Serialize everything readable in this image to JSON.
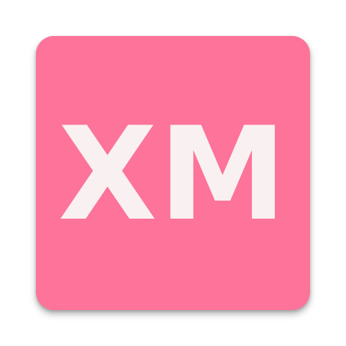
{
  "icon": {
    "text": "XM",
    "background_color": "#FD7399",
    "text_color": "#F9F1F1"
  }
}
